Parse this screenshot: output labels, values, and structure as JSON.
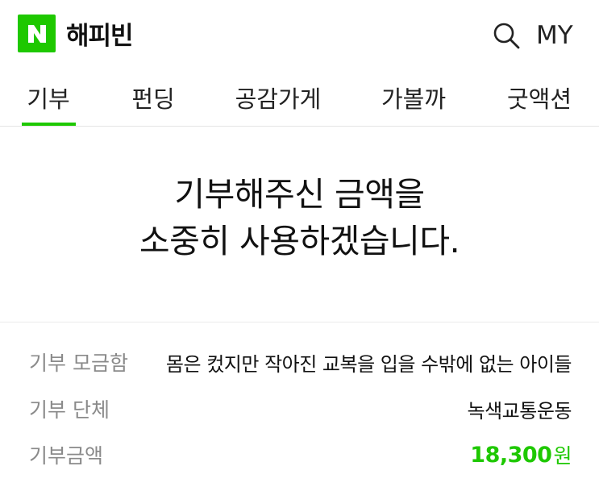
{
  "header": {
    "logo_letter": "N",
    "brand": "해피빈",
    "search_icon": "search-icon",
    "my_label": "MY",
    "brand_color": "#1ec800"
  },
  "tabs": [
    {
      "label": "기부",
      "active": true
    },
    {
      "label": "펀딩",
      "active": false
    },
    {
      "label": "공감가게",
      "active": false
    },
    {
      "label": "가볼까",
      "active": false
    },
    {
      "label": "굿액션",
      "active": false
    }
  ],
  "thanks": {
    "line1": "기부해주신 금액을",
    "line2": "소중히 사용하겠습니다."
  },
  "details": {
    "campaign_label": "기부 모금함",
    "campaign_value": "몸은 컸지만 작아진 교복을 입을 수밖에 없는 아이들",
    "org_label": "기부 단체",
    "org_value": "녹색교통운동",
    "amount_label": "기부금액",
    "amount_value": "18,300",
    "amount_unit": "원",
    "amount_color": "#1ec800"
  }
}
